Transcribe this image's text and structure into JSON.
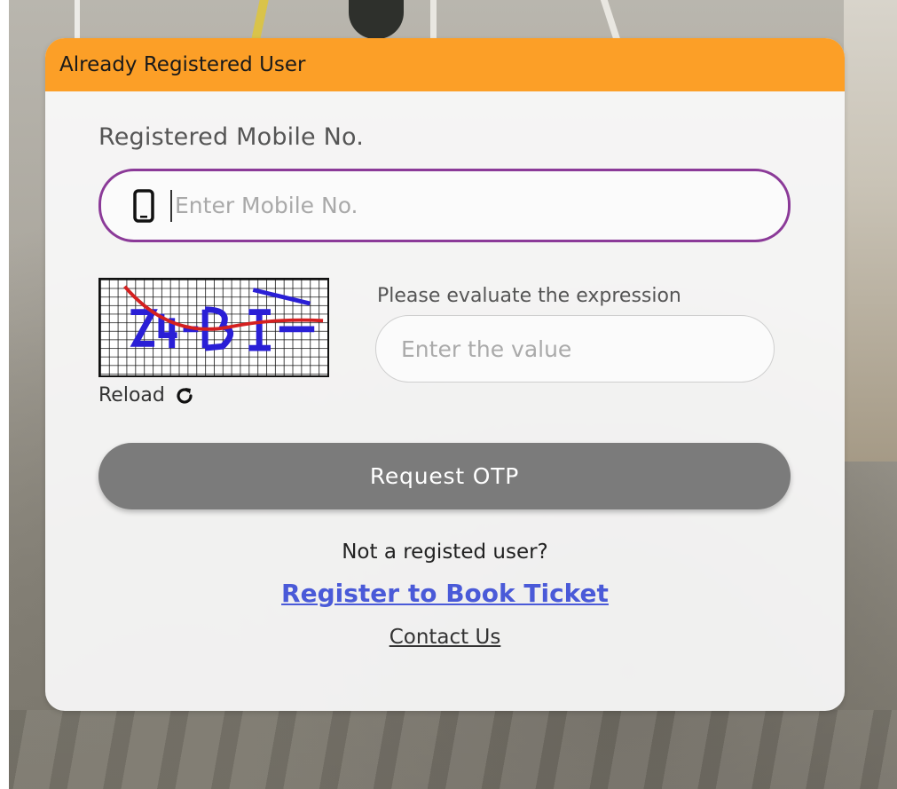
{
  "header": {
    "title": "Already Registered User"
  },
  "mobile": {
    "label": "Registered Mobile No.",
    "placeholder": "Enter Mobile No.",
    "value": "",
    "icon": "mobile-phone-icon"
  },
  "captcha": {
    "image_text": "Z4-BI-",
    "reload_label": "Reload",
    "reload_icon": "refresh-icon",
    "prompt": "Please evaluate the expression",
    "placeholder": "Enter the value",
    "value": ""
  },
  "actions": {
    "request_otp_label": "Request OTP"
  },
  "footer": {
    "not_registered_text": "Not a registed user?",
    "register_link": "Register to Book Ticket",
    "contact_link": "Contact Us"
  },
  "colors": {
    "header_bg": "#fc9f27",
    "mobile_border": "#8b3a98",
    "button_bg": "#7b7b7b",
    "register_link": "#4a5ad8"
  }
}
